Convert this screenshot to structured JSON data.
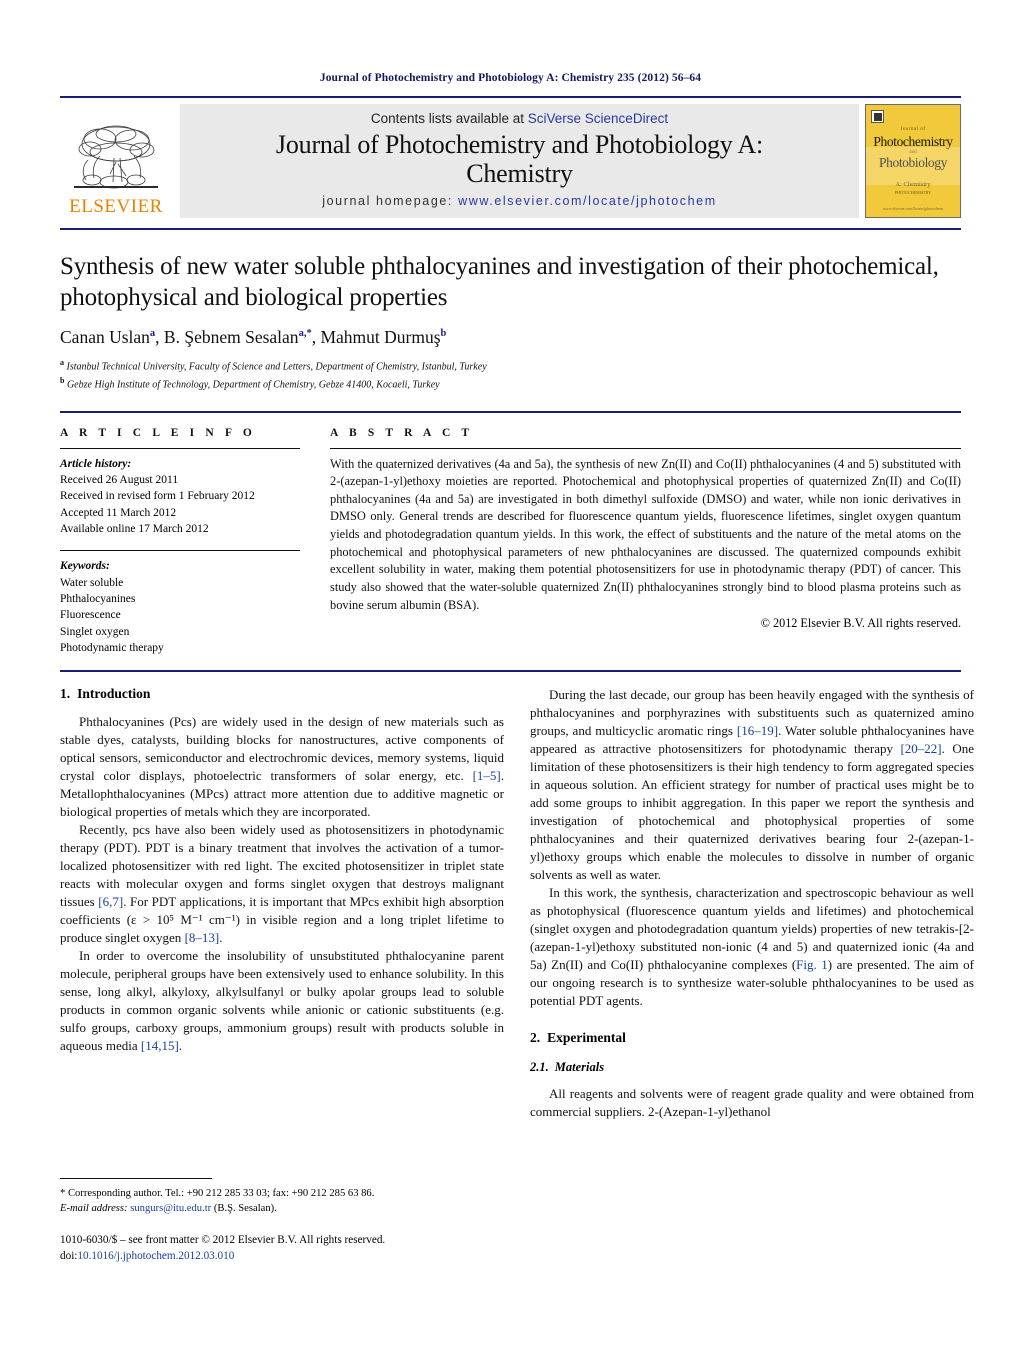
{
  "running_head": "Journal of Photochemistry and Photobiology A: Chemistry 235 (2012) 56–64",
  "masthead": {
    "publisher_name": "ELSEVIER",
    "contents_prefix": "Contents lists available at ",
    "contents_link": "SciVerse ScienceDirect",
    "journal_title_line1": "Journal of Photochemistry and Photobiology A:",
    "journal_title_line2": "Chemistry",
    "homepage_label": "journal homepage:",
    "homepage_url": "www.elsevier.com/locate/jphotochem",
    "cover": {
      "small_top": "Journal of",
      "line1": "Photochemistry",
      "and": "and",
      "line2": "Photobiology",
      "subtitle": "A: Chemistry",
      "subtitle2": "PHOTOCHEMISTRY",
      "footer": "www.elsevier.com/locate/jphotochem"
    }
  },
  "paper": {
    "title": "Synthesis of new water soluble phthalocyanines and investigation of their photochemical, photophysical and biological properties",
    "authors": "Canan Uslan, B. Şebnem Sesalan, Mahmut Durmuş",
    "author_marks": {
      "a1": "a",
      "a2": "a,*",
      "a3": "b"
    },
    "author_parts": {
      "p1": "Canan Uslan",
      "p2": ", B. Şebnem Sesalan",
      "p3": ", Mahmut Durmuş"
    },
    "affiliations": [
      {
        "mark": "a",
        "text": "Istanbul Technical University, Faculty of Science and Letters, Department of Chemistry, Istanbul, Turkey"
      },
      {
        "mark": "b",
        "text": "Gebze High Institute of Technology, Department of Chemistry, Gebze 41400, Kocaeli, Turkey"
      }
    ]
  },
  "article_info": {
    "heading": "A R T I C L E    I N F O",
    "history_label": "Article history:",
    "history": [
      "Received 26 August 2011",
      "Received in revised form 1 February 2012",
      "Accepted 11 March 2012",
      "Available online 17 March 2012"
    ],
    "keywords_label": "Keywords:",
    "keywords": [
      "Water soluble",
      "Phthalocyanines",
      "Fluorescence",
      "Singlet oxygen",
      "Photodynamic therapy"
    ]
  },
  "abstract": {
    "heading": "A B S T R A C T",
    "text": "With the quaternized derivatives (4a and 5a), the synthesis of new Zn(II) and Co(II) phthalocyanines (4 and 5) substituted with 2-(azepan-1-yl)ethoxy moieties are reported. Photochemical and photophysical properties of quaternized Zn(II) and Co(II) phthalocyanines (4a and 5a) are investigated in both dimethyl sulfoxide (DMSO) and water, while non ionic derivatives in DMSO only. General trends are described for fluorescence quantum yields, fluorescence lifetimes, singlet oxygen quantum yields and photodegradation quantum yields. In this work, the effect of substituents and the nature of the metal atoms on the photochemical and photophysical parameters of new phthalocyanines are discussed. The quaternized compounds exhibit excellent solubility in water, making them potential photosensitizers for use in photodynamic therapy (PDT) of cancer. This study also showed that the water-soluble quaternized Zn(II) phthalocyanines strongly bind to blood plasma proteins such as bovine serum albumin (BSA).",
    "copyright": "© 2012 Elsevier B.V. All rights reserved."
  },
  "sections": {
    "introduction": {
      "num": "1.",
      "title": "Introduction"
    },
    "experimental": {
      "num": "2.",
      "title": "Experimental"
    },
    "materials": {
      "num": "2.1.",
      "title": "Materials"
    }
  },
  "left_column": {
    "p1_a": "Phthalocyanines (Pcs) are widely used in the design of new materials such as stable dyes, catalysts, building blocks for nanostructures, active components of optical sensors, semiconductor and electrochromic devices, memory systems, liquid crystal color displays, photoelectric transformers of solar energy, etc. ",
    "p1_ref": "[1–5]",
    "p1_b": ". Metallophthalocyanines (MPcs) attract more attention due to additive magnetic or biological properties of metals which they are incorporated.",
    "p2_a": "Recently, pcs have also been widely used as photosensitizers in photodynamic therapy (PDT). PDT is a binary treatment that involves the activation of a tumor-localized photosensitizer with red light. The excited photosensitizer in triplet state reacts with molecular oxygen and forms singlet oxygen that destroys malignant tissues ",
    "p2_ref1": "[6,7]",
    "p2_b": ". For PDT applications, it is important that MPcs exhibit high absorption coefficients (ε > 10⁵ M⁻¹ cm⁻¹) in visible region and a long triplet lifetime to produce singlet oxygen ",
    "p2_ref2": "[8–13]",
    "p2_c": ".",
    "p3_a": "In order to overcome the insolubility of unsubstituted phthalocyanine parent molecule, peripheral groups have been extensively used to enhance solubility. In this sense, long alkyl, alkyloxy, alkylsulfanyl or bulky apolar groups lead to soluble products in common organic solvents while anionic or cationic substituents (e.g. sulfo groups, carboxy groups, ammonium groups) result with products soluble in aqueous media ",
    "p3_ref": "[14,15]",
    "p3_b": "."
  },
  "right_column": {
    "p1_a": "During the last decade, our group has been heavily engaged with the synthesis of phthalocyanines and porphyrazines with substituents such as quaternized amino groups, and multicyclic aromatic rings ",
    "p1_ref1": "[16–19]",
    "p1_b": ". Water soluble phthalocyanines have appeared as attractive photosensitizers for photodynamic therapy ",
    "p1_ref2": "[20–22]",
    "p1_c": ". One limitation of these photosensitizers is their high tendency to form aggregated species in aqueous solution. An efficient strategy for number of practical uses might be to add some groups to inhibit aggregation. In this paper we report the synthesis and investigation of photochemical and photophysical properties of some phthalocyanines and their quaternized derivatives bearing four 2-(azepan-1-yl)ethoxy groups which enable the molecules to dissolve in number of organic solvents as well as water.",
    "p2_a": "In this work, the synthesis, characterization and spectroscopic behaviour as well as photophysical (fluorescence quantum yields and lifetimes) and photochemical (singlet oxygen and photodegradation quantum yields) properties of new tetrakis-[2-(azepan-1-yl)ethoxy substituted non-ionic (4 and 5) and quaternized ionic (4a and 5a) Zn(II) and Co(II) phthalocyanine complexes (",
    "p2_ref": "Fig. 1",
    "p2_b": ") are presented. The aim of our ongoing research is to synthesize water-soluble phthalocyanines to be used as potential PDT agents.",
    "p3": "All reagents and solvents were of reagent grade quality and were obtained from commercial suppliers. 2-(Azepan-1-yl)ethanol"
  },
  "footnote": {
    "corresponding": "* Corresponding author. Tel.: +90 212 285 33 03; fax: +90 212 285 63 86.",
    "email_label": "E-mail address:",
    "email": "sungurs@itu.edu.tr",
    "email_suffix": " (B.Ş. Sesalan).",
    "imprint_line1": "1010-6030/$ – see front matter © 2012 Elsevier B.V. All rights reserved.",
    "doi_label": "doi:",
    "doi": "10.1016/j.jphotochem.2012.03.010"
  },
  "colors": {
    "rule_navy": "#1b1f6b",
    "link_blue": "#1a3fa0",
    "elsevier_orange": "#f08000",
    "cover_yellow": "#f2c93b"
  }
}
